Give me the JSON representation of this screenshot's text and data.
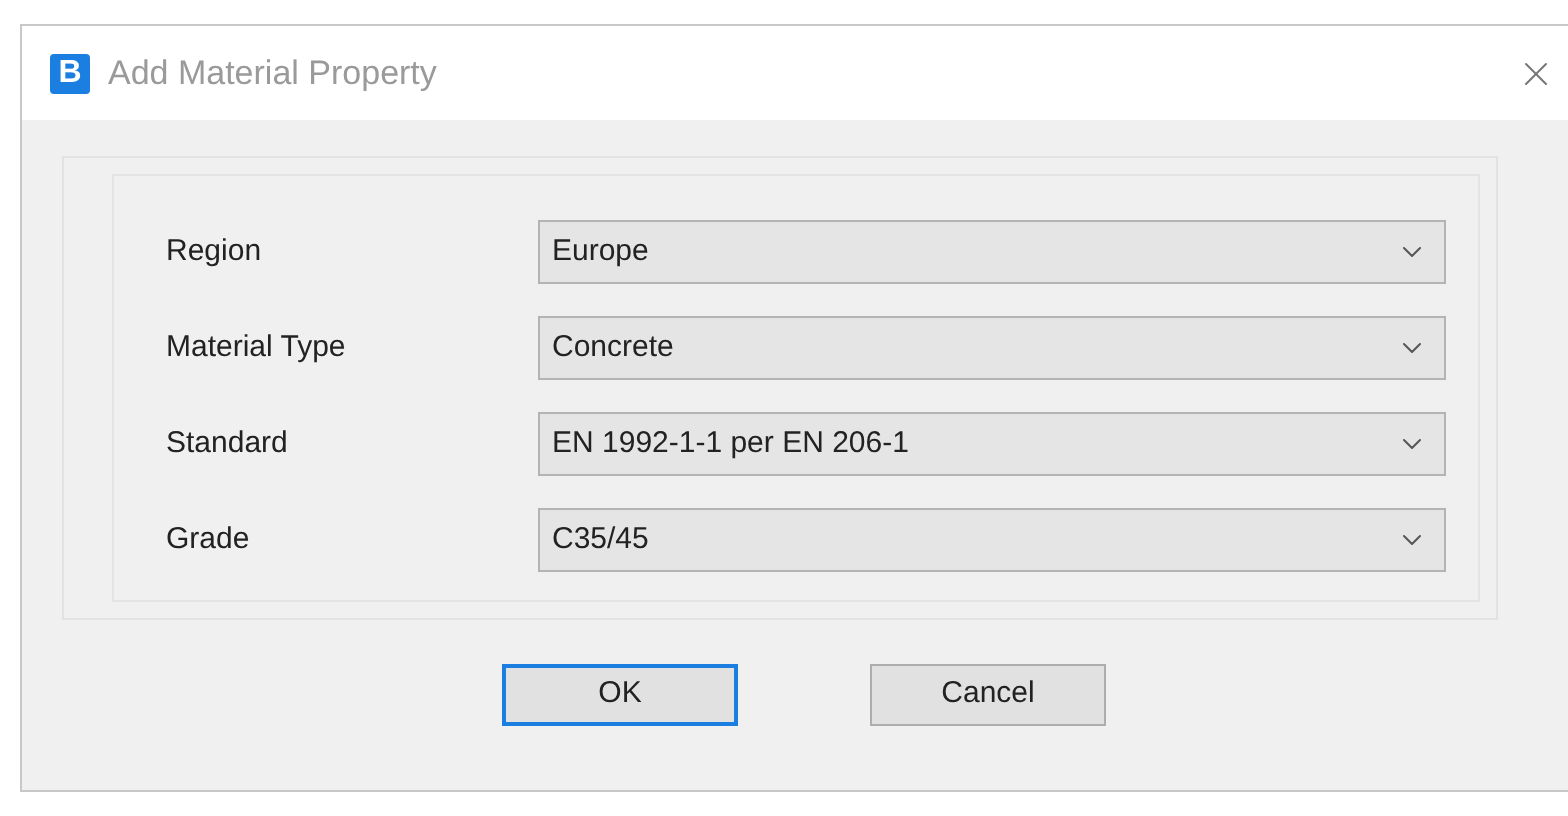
{
  "window": {
    "title": "Add Material Property",
    "icon_letter": "B"
  },
  "fields": [
    {
      "label": "Region",
      "value": "Europe"
    },
    {
      "label": "Material Type",
      "value": "Concrete"
    },
    {
      "label": "Standard",
      "value": "EN 1992-1-1 per EN 206-1"
    },
    {
      "label": "Grade",
      "value": "C35/45"
    }
  ],
  "buttons": [
    {
      "label": "OK",
      "default": true
    },
    {
      "label": "Cancel",
      "default": false
    }
  ]
}
